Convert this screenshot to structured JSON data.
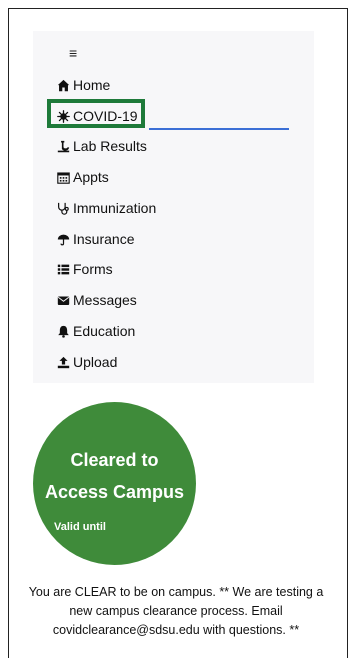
{
  "menu": {
    "hamburger_glyph": "≡",
    "items": [
      {
        "label": "Home",
        "icon": "home-icon"
      },
      {
        "label": "COVID-19",
        "icon": "virus-icon",
        "active": true
      },
      {
        "label": "Lab Results",
        "icon": "lab-icon"
      },
      {
        "label": "Appts",
        "icon": "calendar-icon"
      },
      {
        "label": "Immunization",
        "icon": "stethoscope-icon"
      },
      {
        "label": "Insurance",
        "icon": "umbrella-icon"
      },
      {
        "label": "Forms",
        "icon": "list-icon"
      },
      {
        "label": "Messages",
        "icon": "envelope-icon"
      },
      {
        "label": "Education",
        "icon": "bell-icon"
      },
      {
        "label": "Upload",
        "icon": "upload-icon"
      }
    ],
    "active_color": "#1e7a3a",
    "underline_color": "#3b6fd6"
  },
  "status": {
    "line1": "Cleared to",
    "line2": "Access Campus",
    "valid_label": "Valid until",
    "badge_color": "#3f8b3a"
  },
  "message": {
    "text": "You are CLEAR to be on campus. ** We are testing a new campus clearance process. Email covidclearance@sdsu.edu with questions. **"
  }
}
